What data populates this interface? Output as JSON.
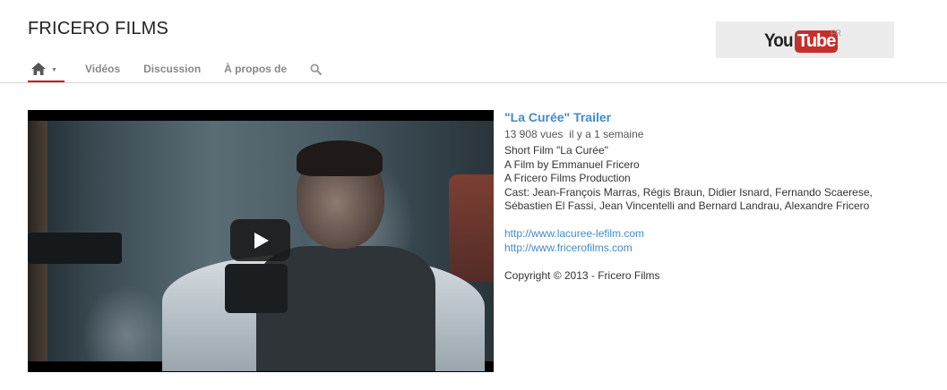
{
  "channel": {
    "title": "FRICERO FILMS"
  },
  "youtube": {
    "logo_you": "You",
    "logo_tube": "Tube",
    "country": "FR"
  },
  "nav": {
    "home_icon": "home-icon",
    "caret": "▼",
    "items": [
      {
        "label": "Vidéos"
      },
      {
        "label": "Discussion"
      },
      {
        "label": "À propos de"
      }
    ],
    "search_icon": "search-icon"
  },
  "video": {
    "title": "\"La Curée\" Trailer",
    "views": "13 908 vues",
    "age": "il y a 1 semaine",
    "description": [
      "Short Film \"La Curée\"",
      "A Film by Emmanuel Fricero",
      "A Fricero Films Production",
      "Cast: Jean-François Marras, Régis Braun, Didier Isnard, Fernando Scaerese,",
      "Sébastien El Fassi, Jean Vincentelli and Bernard Landrau, Alexandre Fricero"
    ],
    "links": [
      "http://www.lacuree-lefilm.com",
      "http://www.fricerofilms.com"
    ],
    "copyright": "Copyright © 2013 - Fricero Films"
  },
  "colors": {
    "accent_red": "#cc181e",
    "link_blue": "#438bc5"
  }
}
